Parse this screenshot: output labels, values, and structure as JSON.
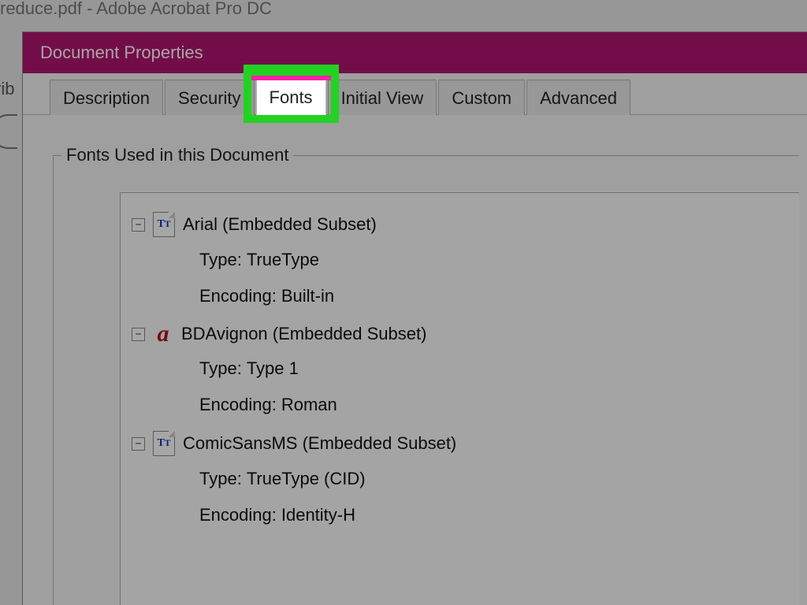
{
  "background_app": {
    "title": "reduce.pdf - Adobe Acrobat Pro DC",
    "sidebar_fragment": "rib"
  },
  "dialog": {
    "title": "Document Properties",
    "tabs": [
      {
        "label": "Description"
      },
      {
        "label": "Security"
      },
      {
        "label": "Fonts"
      },
      {
        "label": "Initial View"
      },
      {
        "label": "Custom"
      },
      {
        "label": "Advanced"
      }
    ],
    "active_tab_index": 2,
    "groupbox_label": "Fonts Used in this Document",
    "type_label": "Type:",
    "encoding_label": "Encoding:",
    "fonts": [
      {
        "name": "Arial (Embedded Subset)",
        "icon": "tt",
        "type": "TrueType",
        "encoding": "Built-in"
      },
      {
        "name": "BDAvignon (Embedded Subset)",
        "icon": "type1",
        "type": "Type 1",
        "encoding": "Roman"
      },
      {
        "name": "ComicSansMS (Embedded Subset)",
        "icon": "tt",
        "type": "TrueType (CID)",
        "encoding": "Identity-H"
      }
    ]
  }
}
